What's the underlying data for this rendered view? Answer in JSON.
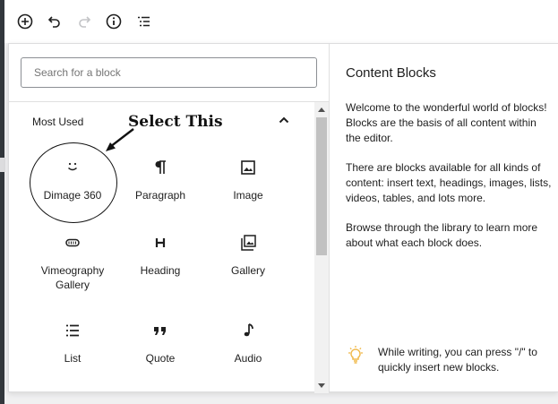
{
  "toolbar": {
    "icons": [
      "add-block-icon",
      "undo-icon",
      "redo-icon",
      "info-icon",
      "list-view-icon"
    ]
  },
  "search": {
    "placeholder": "Search for a block",
    "value": ""
  },
  "group": {
    "label": "Most Used"
  },
  "blocks": [
    {
      "label": "Dimage 360",
      "icon": "smiley-icon"
    },
    {
      "label": "Paragraph",
      "icon": "paragraph-icon"
    },
    {
      "label": "Image",
      "icon": "image-icon"
    },
    {
      "label": "Vimeography Gallery",
      "icon": "vimeography-icon"
    },
    {
      "label": "Heading",
      "icon": "heading-icon"
    },
    {
      "label": "Gallery",
      "icon": "gallery-icon"
    },
    {
      "label": "List",
      "icon": "list-icon"
    },
    {
      "label": "Quote",
      "icon": "quote-icon"
    },
    {
      "label": "Audio",
      "icon": "audio-icon"
    }
  ],
  "annotation": {
    "text": "Select This"
  },
  "help": {
    "title": "Content Blocks",
    "paragraphs": [
      "Welcome to the wonderful world of blocks! Blocks are the basis of all content within the editor.",
      "There are blocks available for all kinds of content: insert text, headings, images, lists, videos, tables, and lots more.",
      "Browse through the library to learn more about what each block does."
    ],
    "tip": "While writing, you can press \"/\" to quickly insert new blocks."
  },
  "colors": {
    "tip_icon": "#f0b849",
    "annotation": "#111111"
  }
}
